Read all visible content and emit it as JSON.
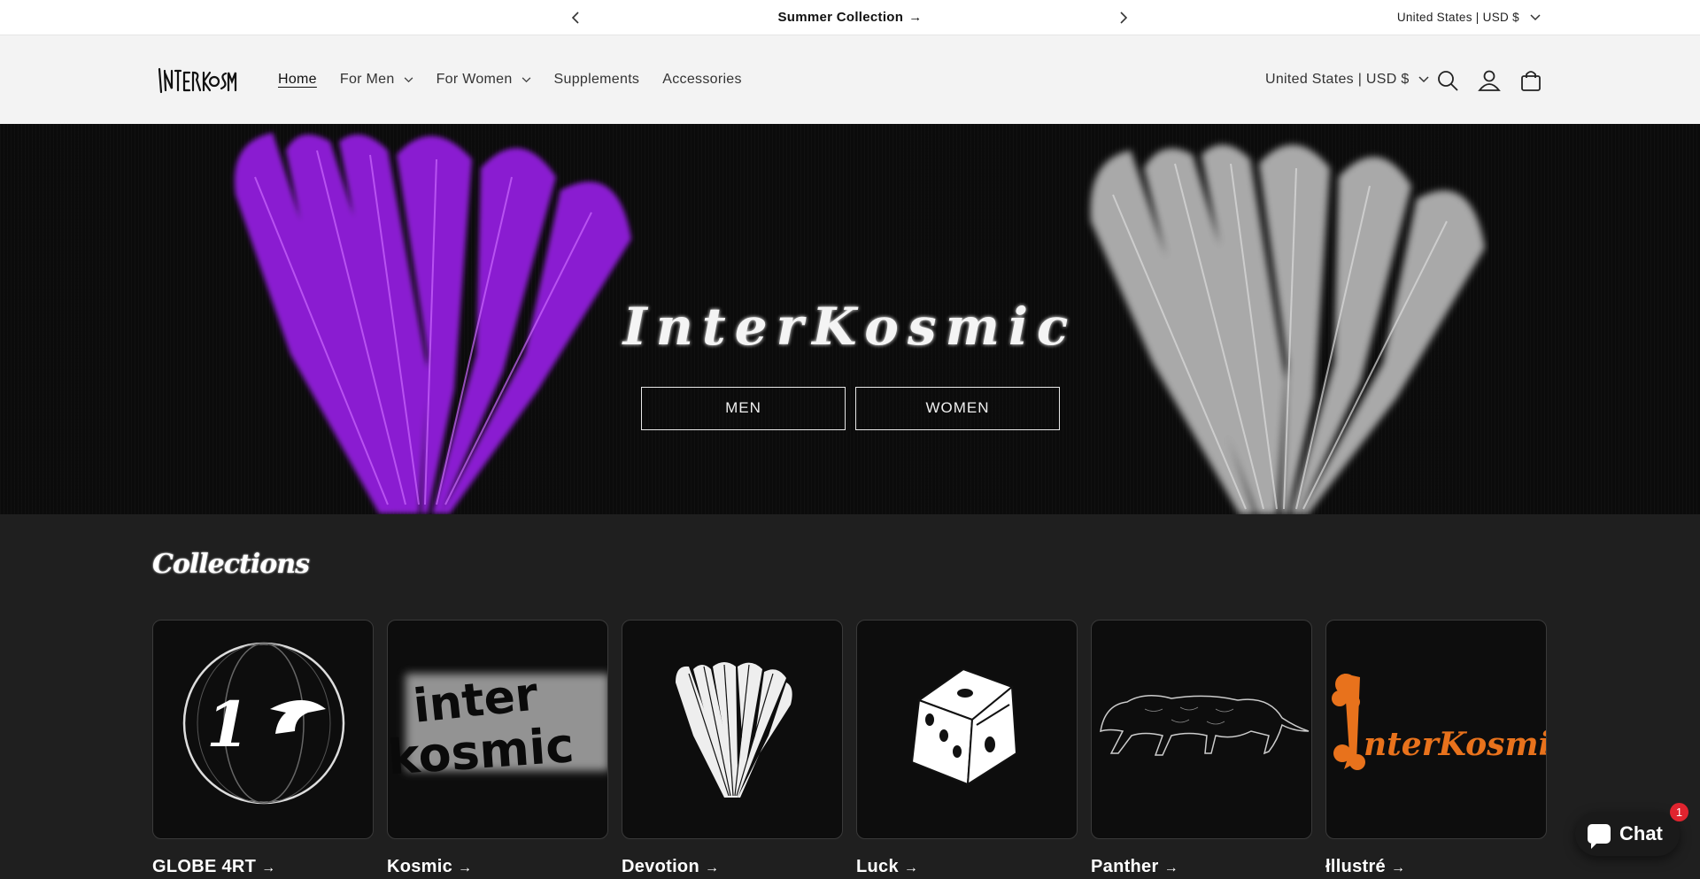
{
  "announcement": {
    "message": "Summer Collection",
    "arrow": "→",
    "prev_icon": "chevron-left-icon",
    "next_icon": "chevron-right-icon",
    "country": "United States | USD $"
  },
  "header": {
    "logo_alt": "InterKosmic",
    "nav": [
      {
        "label": "Home",
        "active": true,
        "dropdown": false
      },
      {
        "label": "For Men",
        "active": false,
        "dropdown": true
      },
      {
        "label": "For Women",
        "active": false,
        "dropdown": true
      },
      {
        "label": "Supplements",
        "active": false,
        "dropdown": false
      },
      {
        "label": "Accessories",
        "active": false,
        "dropdown": false
      }
    ],
    "country": "United States | USD $",
    "icons": [
      "search-icon",
      "account-icon",
      "cart-icon"
    ]
  },
  "hero": {
    "brand": "InterKosmic",
    "men_button": "MEN",
    "women_button": "WOMEN",
    "colors": {
      "left_heart": "#8a1fd1",
      "right_heart": "#a9a9a9"
    }
  },
  "collections": {
    "title": "Collections",
    "items": [
      {
        "label": "GLOBE 4RT",
        "image": "globe-art"
      },
      {
        "label": "Kosmic",
        "image": "kosmic-text"
      },
      {
        "label": "Devotion",
        "image": "white-heart"
      },
      {
        "label": "Luck",
        "image": "dice"
      },
      {
        "label": "Panther",
        "image": "panther"
      },
      {
        "label": "łllustré",
        "image": "orange-logo"
      }
    ],
    "arrow": "→"
  },
  "chat": {
    "label": "Chat",
    "badge": "1"
  }
}
